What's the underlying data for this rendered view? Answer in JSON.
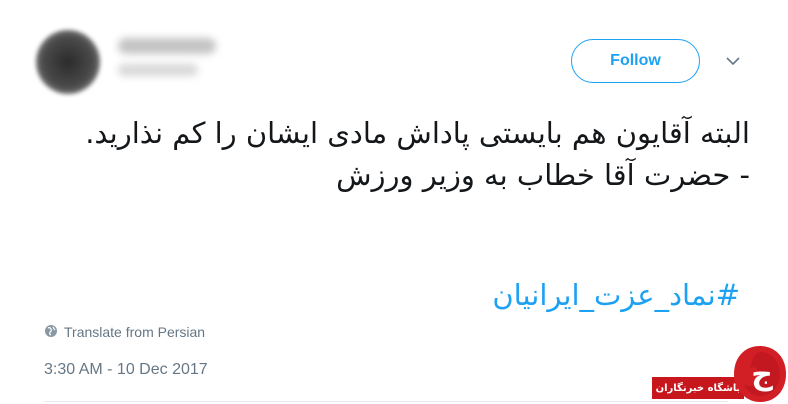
{
  "tweet": {
    "follow_label": "Follow",
    "text": "البته آقایون هم بایستی پاداش مادی ایشان را کم نذارید.\n- حضرت آقا خطاب به وزیر ورزش",
    "hashtag": "#نماد_عزت_ایرانیان",
    "translate_label": "Translate from Persian",
    "timestamp": "3:30 AM - 10 Dec 2017"
  },
  "watermark": {
    "text": "باشگاه خبرنگاران",
    "logo_letter": "ج"
  },
  "colors": {
    "accent": "#1da1f2",
    "text": "#14171a",
    "muted": "#657786",
    "watermark_red": "#c8161d"
  },
  "icons": {
    "caret": "chevron-down-icon",
    "translate": "globe-icon"
  }
}
